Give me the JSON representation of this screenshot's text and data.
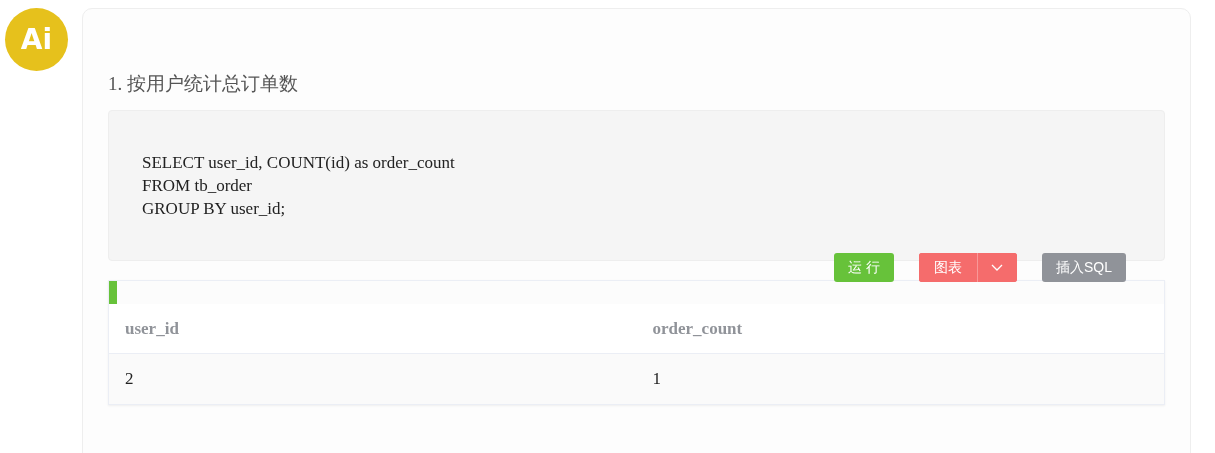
{
  "avatar": {
    "label": "Ai"
  },
  "heading": "1. 按用户统计总订单数",
  "code": [
    "SELECT user_id, COUNT(id) as order_count",
    "FROM tb_order",
    "GROUP BY user_id;"
  ],
  "buttons": [
    {
      "kind": "run",
      "label": "运 行"
    },
    {
      "kind": "split",
      "label": "图表"
    },
    {
      "kind": "insert",
      "label": "插入SQL"
    }
  ],
  "table": {
    "columns": [
      "user_id",
      "order_count"
    ],
    "rows": [
      [
        "2",
        "1"
      ]
    ]
  }
}
